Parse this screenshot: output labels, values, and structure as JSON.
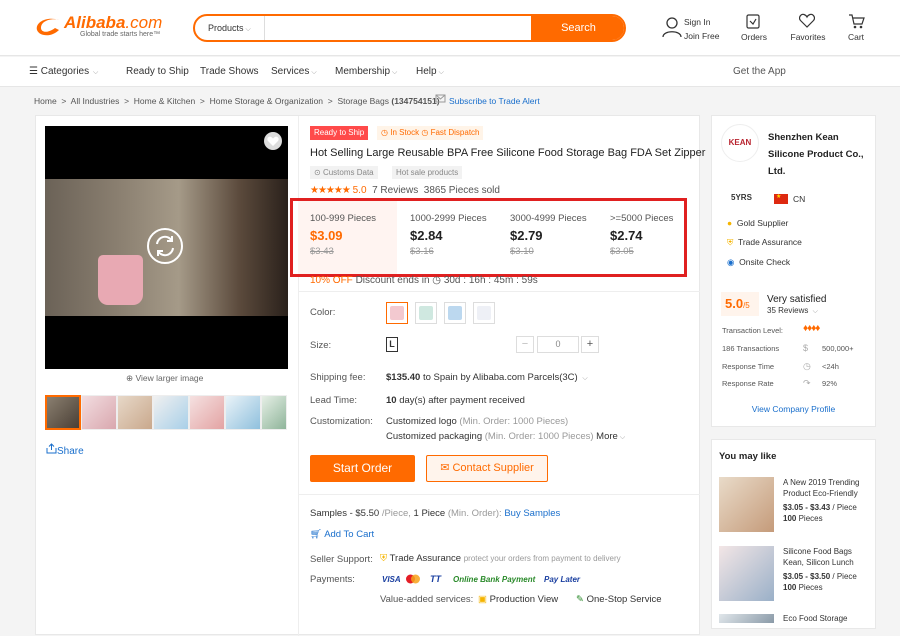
{
  "header": {
    "logo": "Alibaba",
    "logo_suffix": ".com",
    "tagline": "Global trade starts here™",
    "search_category": "Products",
    "search_placeholder": "",
    "search_button": "Search",
    "signin": "Sign In",
    "joinfree": "Join Free",
    "orders": "Orders",
    "favorites": "Favorites",
    "cart": "Cart"
  },
  "nav": {
    "categories": "Categories",
    "items": [
      "Ready to Ship",
      "Trade Shows",
      "Services",
      "Membership",
      "Help"
    ],
    "get_app": "Get the App"
  },
  "breadcrumb": {
    "items": [
      "Home",
      ">",
      "All Industries",
      ">",
      "Home & Kitchen",
      ">",
      "Home Storage & Organization",
      ">",
      "Storage Bags",
      "(134754151)"
    ],
    "subscribe": "Subscribe to Trade Alert"
  },
  "gallery": {
    "view_larger": "View larger image",
    "share": "Share"
  },
  "product": {
    "badge_ready": "Ready to Ship",
    "badge_stock": "In Stock",
    "badge_dispatch": "Fast Dispatch",
    "title": "Hot Selling Large Reusable BPA Free Silicone Food Storage Bag FDA Set Zipper",
    "tag1": "Customs Data",
    "tag2": "Hot sale products",
    "rating": "5.0",
    "reviews": "7 Reviews",
    "sold": "3865 Pieces sold",
    "tiers": [
      {
        "qty": "100-999 Pieces",
        "price": "$3.09",
        "old": "$3.43"
      },
      {
        "qty": "1000-2999 Pieces",
        "price": "$2.84",
        "old": "$3.16"
      },
      {
        "qty": "3000-4999 Pieces",
        "price": "$2.79",
        "old": "$3.10"
      },
      {
        "qty": ">=5000 Pieces",
        "price": "$2.74",
        "old": "$3.05"
      }
    ],
    "discount": "10% OFF",
    "discount_ends": "Discount ends in",
    "timer": "30d : 16h : 45m : 59s",
    "color_label": "Color:",
    "size_label": "Size:",
    "size_value": "L",
    "qty": "0",
    "qty_minus": "−",
    "qty_plus": "+",
    "shipping_label": "Shipping fee:",
    "shipping_price": "$135.40",
    "shipping_text": "to Spain by Alibaba.com Parcels(3C)",
    "lead_label": "Lead Time:",
    "lead_days": "10",
    "lead_text": "day(s) after payment received",
    "custom_label": "Customization:",
    "custom1": "Customized logo",
    "custom1_min": "(Min. Order: 1000 Pieces)",
    "custom2": "Customized packaging",
    "custom2_min": "(Min. Order: 1000 Pieces)",
    "more": "More",
    "start_order": "Start Order",
    "contact": "Contact Supplier",
    "samples": "Samples - $5.50",
    "samples_unit": "/Piece,",
    "samples_qty": "1 Piece",
    "samples_min": "(Min. Order):",
    "buy_samples": "Buy Samples",
    "add_cart": "Add To Cart",
    "seller_label": "Seller Support:",
    "trade_assurance": "Trade Assurance",
    "trade_text": "protect your orders from payment to delivery",
    "payments_label": "Payments:",
    "pay": [
      "VISA",
      "TT",
      "Online Bank Payment",
      "Pay Later"
    ],
    "value_label": "Value-added services:",
    "prod_view": "Production View",
    "one_stop": "One-Stop Service"
  },
  "supplier": {
    "logo": "KEAN",
    "name1": "Shenzhen Kean",
    "name2": "Silicone Product Co.,",
    "name3": "Ltd.",
    "years": "5YRS",
    "country": "CN",
    "gold": "Gold Supplier",
    "ta": "Trade Assurance",
    "onsite": "Onsite Check",
    "score": "5.0",
    "score_of": "/5",
    "satisfaction": "Very satisfied",
    "reviews": "35 Reviews",
    "tl_label": "Transaction Level:",
    "transactions": "186 Transactions",
    "amount": "500,000+",
    "rt_label": "Response Time",
    "rt": "<24h",
    "rr_label": "Response Rate",
    "rr": "92%",
    "view": "View Company Profile"
  },
  "you_may_like": {
    "title": "You may like",
    "items": [
      {
        "name1": "A New 2019 Trending",
        "name2": "Product Eco-Friendly",
        "price": "$3.05 - $3.43",
        "unit": "/ Piece",
        "min": "100",
        "min_unit": "Pieces"
      },
      {
        "name1": "Silicone Food Bags",
        "name2": "Kean, Silicon Lunch",
        "price": "$3.05 - $3.50",
        "unit": "/ Piece",
        "min": "100",
        "min_unit": "Pieces"
      },
      {
        "name1": "Eco Food Storage"
      }
    ]
  },
  "colors": {
    "accent": "#ff6a00",
    "link": "#1a6fcc",
    "highlight": "#e02020"
  }
}
